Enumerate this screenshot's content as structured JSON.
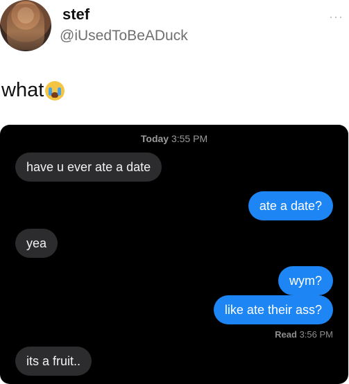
{
  "tweet": {
    "display_name": "stef",
    "handle": "@iUsedToBeADuck",
    "more_icon": "···",
    "text": "what",
    "emoji": "loudly-crying-face"
  },
  "chat": {
    "timestamp_day": "Today",
    "timestamp_time": "3:55 PM",
    "messages": [
      {
        "from": "them",
        "text": "have u ever ate a date"
      },
      {
        "from": "me",
        "text": "ate a date?"
      },
      {
        "from": "them",
        "text": "yea"
      },
      {
        "from": "me",
        "text": "wym?"
      },
      {
        "from": "me",
        "text": "like ate their ass?"
      },
      {
        "from": "them",
        "text": "its a fruit.."
      }
    ],
    "read_label": "Read",
    "read_time": "3:56 PM"
  },
  "colors": {
    "outgoing_bubble": "#1e86f4",
    "incoming_bubble": "#2c2c2e",
    "chat_background": "#000000"
  }
}
